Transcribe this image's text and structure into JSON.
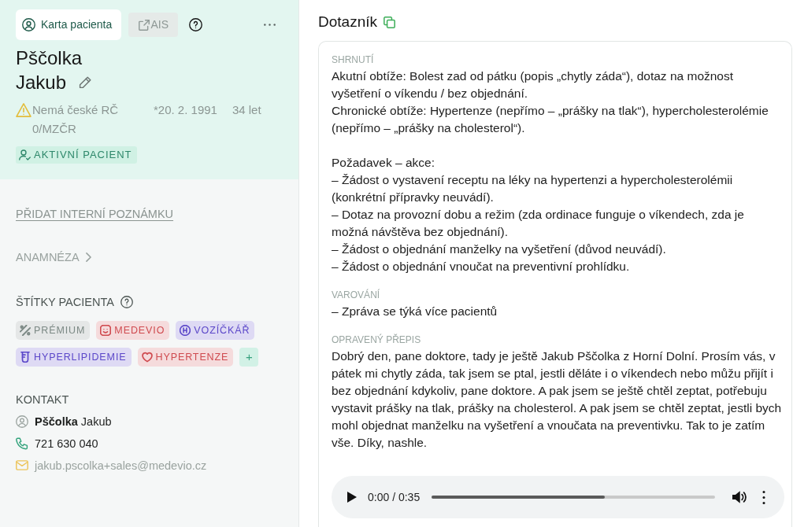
{
  "patient_panel": {
    "toolbar": {
      "card_button": {
        "label": "Karta pacienta"
      },
      "ais_button": {
        "label": "AIS",
        "disabled": true
      }
    },
    "surname": "Pščolka",
    "first_name": "Jakub",
    "id_warning": "Nemá české RČ 0/MZČR",
    "birth_date": "*20. 2. 1991",
    "age": "34 let",
    "status_badge": "AKTIVNÍ PACIENT",
    "add_note_link": "PŘIDAT INTERNÍ POZNÁMKU",
    "anamnesis_link": "ANAMNÉZA",
    "tags": {
      "title": "ŠTÍTKY PACIENTA",
      "items": [
        {
          "label": "PRÉMIUM",
          "color": "#7c8985"
        },
        {
          "label": "MEDEVIO",
          "color": "#cf4a4f"
        },
        {
          "label": "VOZÍČKÁŘ",
          "color": "#5b47c9"
        },
        {
          "label": "HYPERLIPIDEMIE",
          "color": "#5b47c9"
        },
        {
          "label": "HYPERTENZE",
          "color": "#cf4a4f"
        }
      ],
      "add_button": "+"
    },
    "contact": {
      "title": "KONTAKT",
      "name": "**Pščolka** Jakub",
      "phone": "721 630 040",
      "email": "jakub.pscolka+sales@medevio.cz"
    }
  },
  "questionnaire": {
    "title": "Dotazník",
    "sections": [
      {
        "label": "SHRNUTÍ",
        "paragraphs": [
          [
            "Akutní obtíže: Bolest zad od pátku (popis „chytly záda“), dotaz na možnost vyšetření o víkendu / bez objednání.",
            "Chronické obtíže: Hypertenze (nepřímo – „prášky na tlak“), hypercholesterolémie (nepřímo – „prášky na cholesterol“)."
          ],
          [
            "Požadavek – akce:",
            "– Žádost o vystavení receptu na léky na hypertenzi a hypercholesterolémii (konkrétní přípravky neuvádí).",
            "– Dotaz na provozní dobu a režim (zda ordinace funguje o víkendech, zda je možná návštěva bez objednání).",
            "– Žádost o objednání manželky na vyšetření (důvod neuvádí).",
            "– Žádost o objednání vnoučat na preventivní prohlídku."
          ]
        ]
      },
      {
        "label": "VAROVÁNÍ",
        "paragraphs": [
          [
            "– Zpráva se týká více pacientů"
          ]
        ]
      },
      {
        "label": "OPRAVENÝ PŘEPIS",
        "paragraphs": [
          [
            "Dobrý den, pane doktore, tady je ještě Jakub Pščolka z Horní Dolní. Prosím vás, v pátek mi chytly záda, tak jsem se ptal, jestli děláte i o víkendech nebo můžu přijít i bez objednání kdykoliv, pane doktore. A pak jsem se ještě chtěl zeptat, potřebuju vystavit prášky na tlak, prášky na cholesterol. A pak jsem se chtěl zeptat, jestli bych mohl objednat manželku na vyšetření a vnoučata na preventivku. Tak to je zatím vše. Díky, nashle."
          ]
        ]
      }
    ],
    "audio_player": {
      "time": "0:00 / 0:35",
      "level": 0.61
    }
  }
}
